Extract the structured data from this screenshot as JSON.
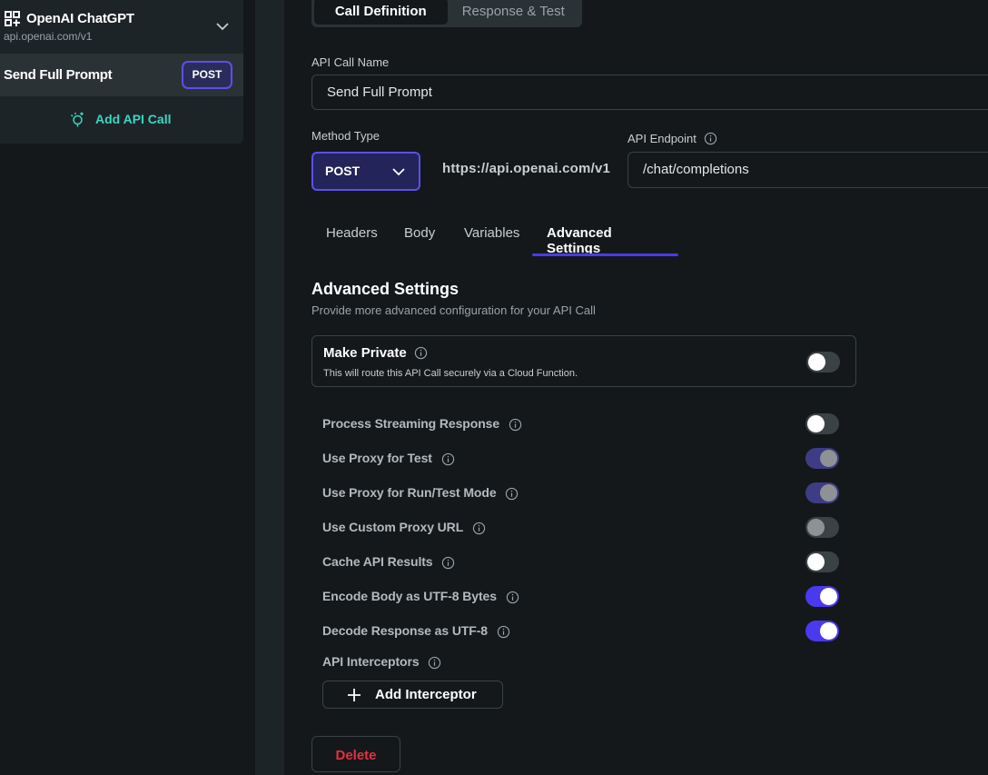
{
  "sidebar": {
    "group": {
      "title": "OpenAI ChatGPT",
      "url": "api.openai.com/v1",
      "icon": "grid-plus-icon"
    },
    "call": {
      "label": "Send Full Prompt",
      "method_badge": "POST"
    },
    "add_call_label": "Add API Call"
  },
  "header": {
    "tabs": [
      "Call Definition",
      "Response & Test"
    ]
  },
  "form": {
    "call_name_label": "API Call Name",
    "call_name_value": "Send Full Prompt",
    "method_label": "Method Type",
    "method_value": "POST",
    "base_url": "https://api.openai.com/v1",
    "endpoint_label": "API Endpoint",
    "endpoint_value": "/chat/completions"
  },
  "sub_tabs": [
    "Headers",
    "Body",
    "Variables",
    "Advanced Settings"
  ],
  "advanced": {
    "title": "Advanced Settings",
    "subtitle": "Provide more advanced configuration for your API Call",
    "private": {
      "title": "Make Private",
      "subtitle": "This will route this API Call securely via a Cloud Function.",
      "enabled": false
    },
    "settings": [
      {
        "label": "Process Streaming Response",
        "state": "off"
      },
      {
        "label": "Use Proxy for Test",
        "state": "on-disabled"
      },
      {
        "label": "Use Proxy for Run/Test Mode",
        "state": "on-disabled"
      },
      {
        "label": "Use Custom Proxy URL",
        "state": "off-disabled"
      },
      {
        "label": "Cache API Results",
        "state": "off"
      },
      {
        "label": "Encode Body as UTF-8 Bytes",
        "state": "on"
      },
      {
        "label": "Decode Response as UTF-8",
        "state": "on"
      }
    ],
    "interceptors_label": "API Interceptors",
    "add_interceptor_label": "Add Interceptor",
    "delete_label": "Delete"
  },
  "colors": {
    "accent": "#4b39ef",
    "teal": "#3ad6c0",
    "danger": "#e5313f",
    "background": "#14181b",
    "surface": "#1d2428"
  }
}
